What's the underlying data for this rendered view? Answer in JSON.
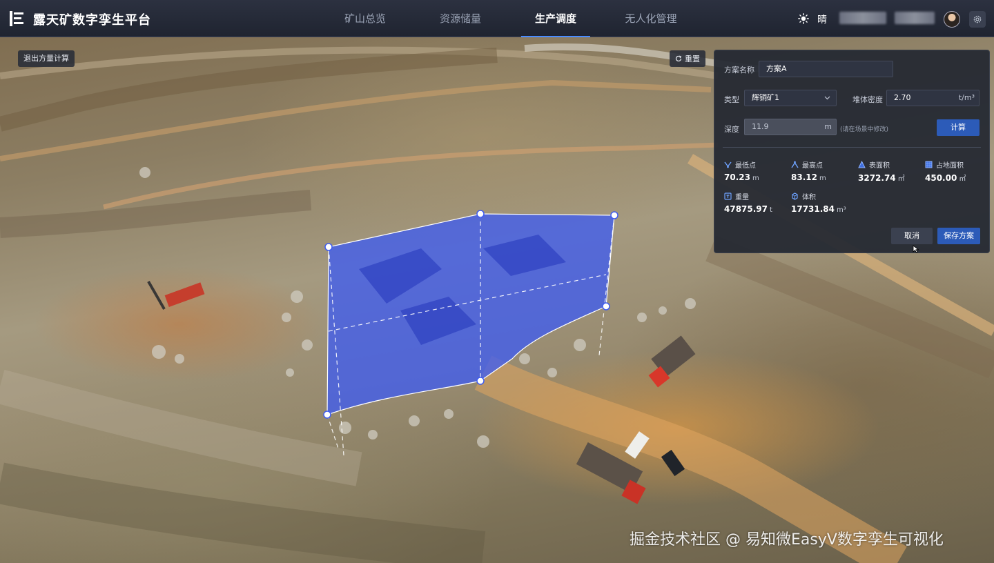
{
  "app": {
    "title": "露天矿数字孪生平台"
  },
  "nav": {
    "tabs": [
      {
        "label": "矿山总览",
        "active": false
      },
      {
        "label": "资源储量",
        "active": false
      },
      {
        "label": "生产调度",
        "active": true
      },
      {
        "label": "无人化管理",
        "active": false
      }
    ]
  },
  "header": {
    "weather_icon": "sun-icon",
    "weather": "晴"
  },
  "toolbar": {
    "exit_label": "退出方量计算",
    "reset_label": "重置"
  },
  "panel": {
    "plan_name_label": "方案名称",
    "plan_name_value": "方案A",
    "type_label": "类型",
    "type_value": "辉铜矿1",
    "density_label": "堆体密度",
    "density_value": "2.70",
    "density_unit": "t/m³",
    "depth_label": "深度",
    "depth_value": "11.9",
    "depth_unit": "m",
    "depth_hint": "(请在场景中修改)",
    "calc_label": "计算",
    "stats": [
      {
        "label": "最低点",
        "value": "70.23",
        "unit": "m",
        "icon": "lowest-point-icon"
      },
      {
        "label": "最高点",
        "value": "83.12",
        "unit": "m",
        "icon": "highest-point-icon"
      },
      {
        "label": "表面积",
        "value": "3272.74",
        "unit": "㎡",
        "icon": "surface-area-icon"
      },
      {
        "label": "占地面积",
        "value": "450.00",
        "unit": "㎡",
        "icon": "footprint-area-icon"
      },
      {
        "label": "重量",
        "value": "47875.97",
        "unit": "t",
        "icon": "weight-icon"
      },
      {
        "label": "体积",
        "value": "17731.84",
        "unit": "m³",
        "icon": "volume-icon"
      }
    ],
    "cancel_label": "取消",
    "save_label": "保存方案"
  },
  "watermark": "掘金技术社区 @ 易知微EasyV数字孪生可视化",
  "colors": {
    "accent": "#2c5bb8",
    "selection": "#3f5cf0",
    "panel_bg": "#242832"
  }
}
